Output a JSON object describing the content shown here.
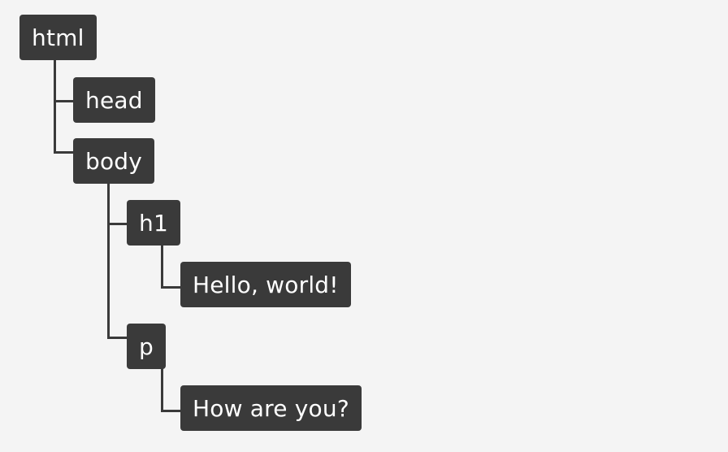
{
  "tree": {
    "html": "html",
    "head": "head",
    "body": "body",
    "h1": "h1",
    "h1_text": "Hello, world!",
    "p": "p",
    "p_text": "How are you?"
  }
}
